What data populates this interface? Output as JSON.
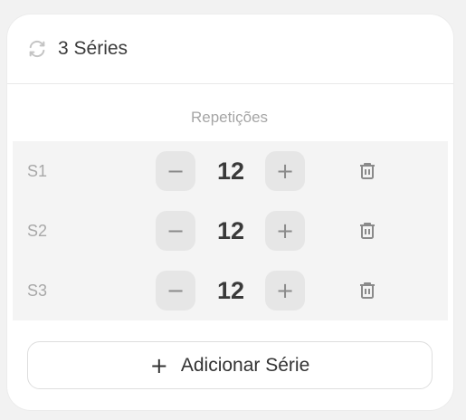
{
  "header": {
    "title": "3 Séries",
    "icon": "refresh-icon"
  },
  "column_header": "Repetições",
  "sets": [
    {
      "label": "S1",
      "reps": "12"
    },
    {
      "label": "S2",
      "reps": "12"
    },
    {
      "label": "S3",
      "reps": "12"
    }
  ],
  "stepper": {
    "minus": "−",
    "plus": "+"
  },
  "add_button": {
    "icon": "+",
    "label": "Adicionar Série"
  },
  "colors": {
    "background": "#f2f2f2",
    "card": "#ffffff",
    "row_bg": "#f4f4f4",
    "button_bg": "#e6e6e6"
  }
}
